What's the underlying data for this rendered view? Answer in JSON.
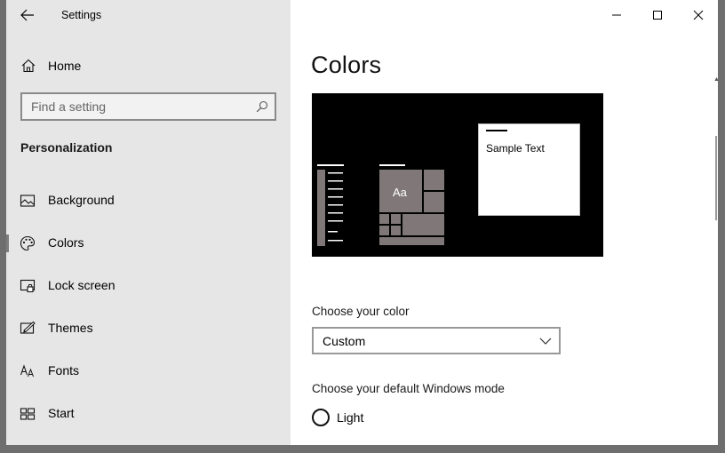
{
  "window": {
    "title": "Settings"
  },
  "sidebar": {
    "home_label": "Home",
    "search_placeholder": "Find a setting",
    "section_title": "Personalization",
    "items": [
      {
        "label": "Background",
        "icon": "image-icon",
        "selected": false
      },
      {
        "label": "Colors",
        "icon": "palette-icon",
        "selected": true
      },
      {
        "label": "Lock screen",
        "icon": "lock-screen-icon",
        "selected": false
      },
      {
        "label": "Themes",
        "icon": "themes-icon",
        "selected": false
      },
      {
        "label": "Fonts",
        "icon": "fonts-icon",
        "selected": false
      },
      {
        "label": "Start",
        "icon": "start-icon",
        "selected": false
      }
    ]
  },
  "main": {
    "title": "Colors",
    "preview": {
      "sample_text": "Sample Text",
      "tile_text": "Aa"
    },
    "choose_color_label": "Choose your color",
    "choose_color_value": "Custom",
    "default_mode_label": "Choose your default Windows mode",
    "mode_option_light": "Light"
  },
  "colors": {
    "sidebar_bg": "#e6e6e6",
    "preview_bg": "#000000",
    "tile_gray": "#807878",
    "selection_bar": "#7d7d7d"
  }
}
